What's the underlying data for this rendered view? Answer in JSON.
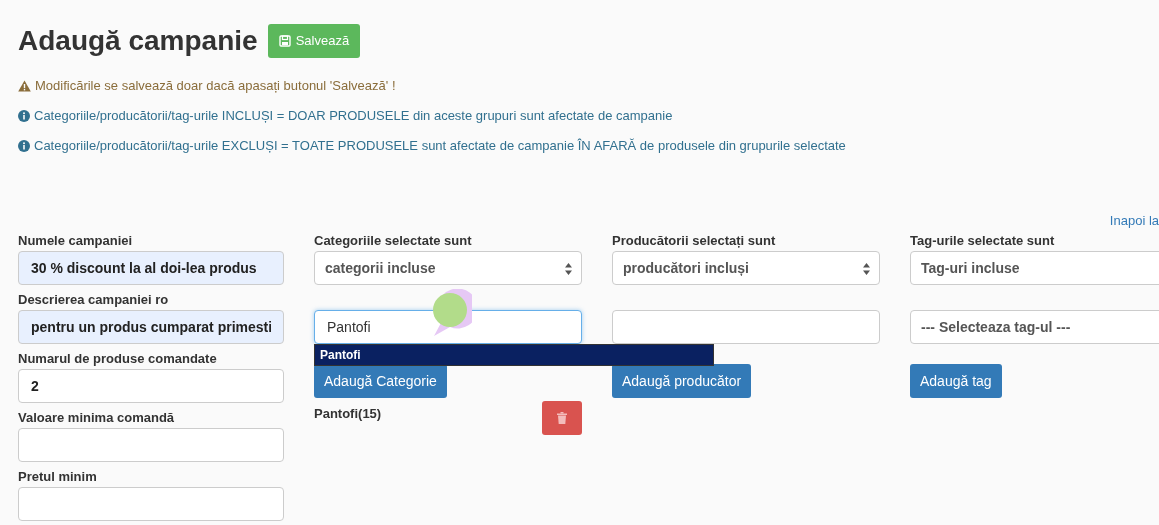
{
  "title": "Adaugă campanie",
  "save_button": "Salvează",
  "notices": [
    {
      "kind": "warning",
      "text": "Modificările se salvează doar dacă apasați butonul 'Salvează' !"
    },
    {
      "kind": "info",
      "text": "Categoriile/producătorii/tag-urile INCLUȘI = DOAR PRODUSELE din aceste grupuri sunt afectate de campanie"
    },
    {
      "kind": "info",
      "text": "Categoriile/producătorii/tag-urile EXCLUȘI = TOATE PRODUSELE sunt afectate de campanie ÎN AFARĂ de produsele din grupurile selectate"
    }
  ],
  "back_link": "Inapoi la",
  "fields": [
    {
      "label": "Numele campaniei",
      "value": "30 % discount la al doi-lea produs",
      "autofilled": true
    },
    {
      "label": "Descrierea campaniei ro",
      "value": "pentru un produs cumparat primesti",
      "autofilled": true
    },
    {
      "label": "Numarul de produse comandate",
      "value": "2",
      "autofilled": false
    },
    {
      "label": "Valoare minima comandă",
      "autofilled": false
    },
    {
      "label": "Pretul minim",
      "autofilled": false
    }
  ],
  "groups": [
    {
      "label": "Categoriile selectate sunt",
      "mode": "categorii incluse",
      "mode_arrows": true,
      "search": {
        "kind": "input",
        "value": "Pantofi",
        "focused": true
      },
      "suggestions": [
        {
          "text": "Pantofi",
          "selected": true
        }
      ],
      "add_button": "Adaugă Categorie",
      "items": [
        {
          "name": "Pantofi(15)"
        }
      ]
    },
    {
      "label": "Producătorii selectați sunt",
      "mode": "producători incluși",
      "mode_arrows": true,
      "search": {
        "kind": "input",
        "focused": false
      },
      "add_button": "Adaugă producător"
    },
    {
      "label": "Tag-urile selectate sunt",
      "mode": "Tag-uri incluse",
      "search": {
        "kind": "select",
        "value": "--- Selecteaza tag-ul ---"
      },
      "add_button": "Adaugă tag"
    }
  ]
}
